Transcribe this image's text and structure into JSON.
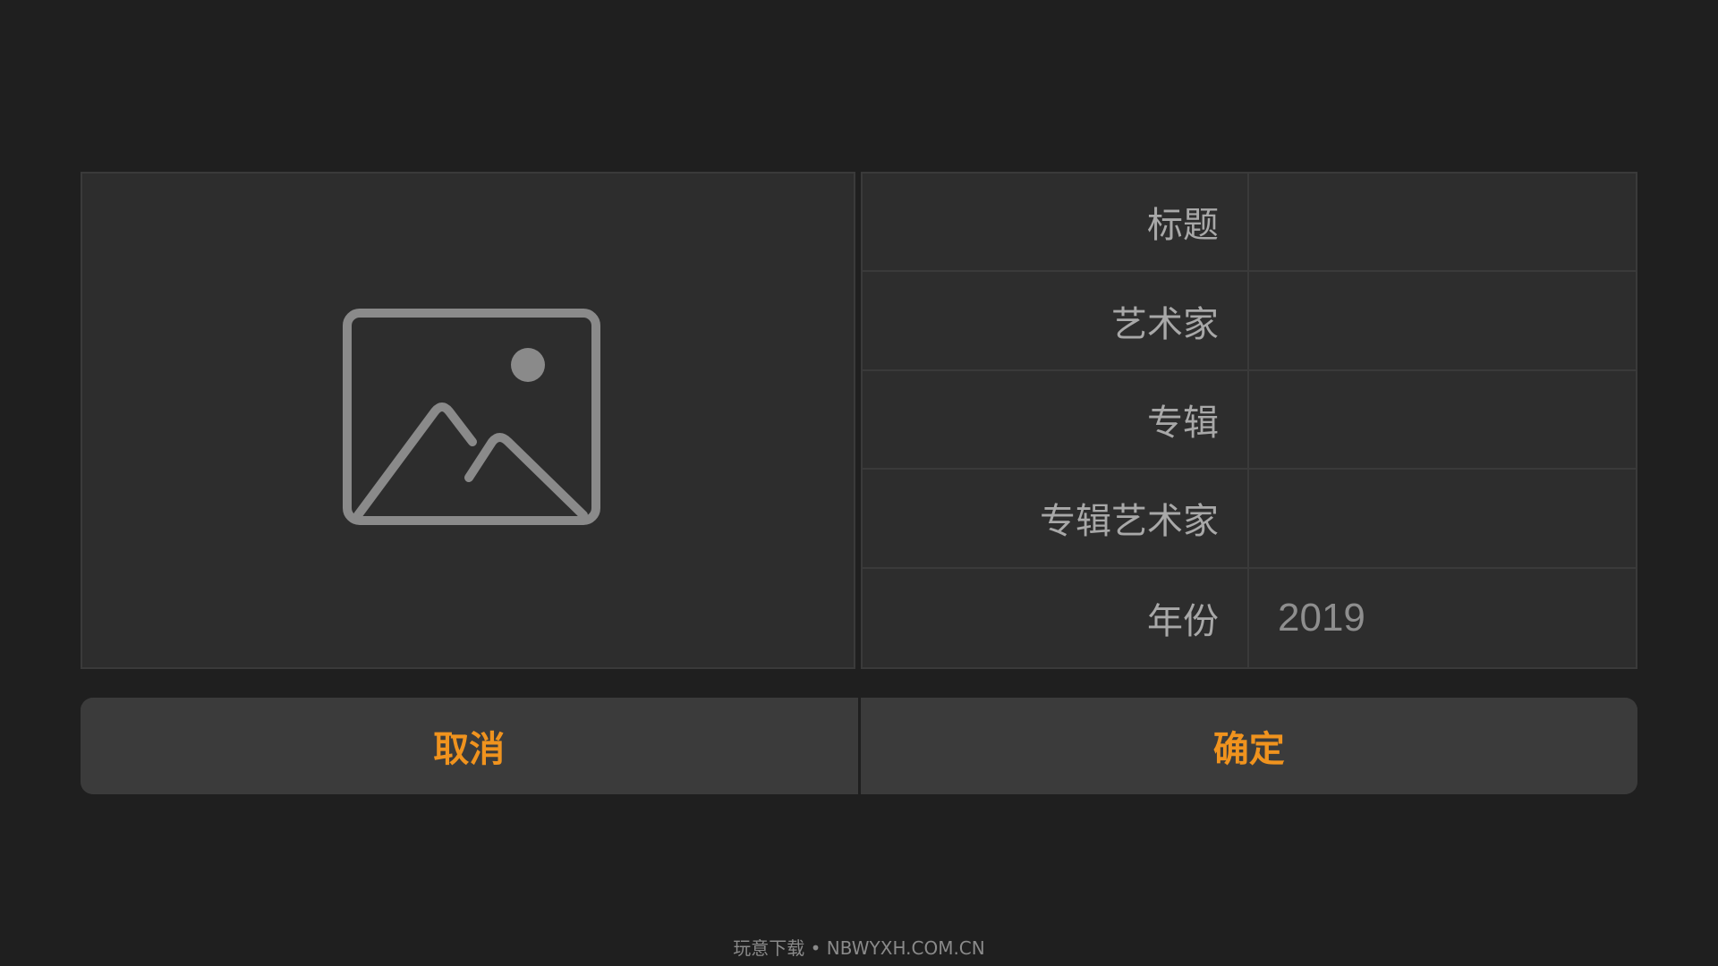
{
  "artwork": {
    "icon": "image-placeholder-icon",
    "placeholder_color": "#8a8a8a"
  },
  "fields": [
    {
      "label": "标题",
      "value": ""
    },
    {
      "label": "艺术家",
      "value": ""
    },
    {
      "label": "专辑",
      "value": ""
    },
    {
      "label": "专辑艺术家",
      "value": ""
    },
    {
      "label": "年份",
      "value": "2019"
    }
  ],
  "actions": {
    "cancel_label": "取消",
    "confirm_label": "确定"
  },
  "colors": {
    "background": "#1f1f1f",
    "panel": "#2d2d2d",
    "accent": "#f0931e"
  },
  "footer": {
    "text": "玩意下载 • NBWYXH.COM.CN"
  }
}
